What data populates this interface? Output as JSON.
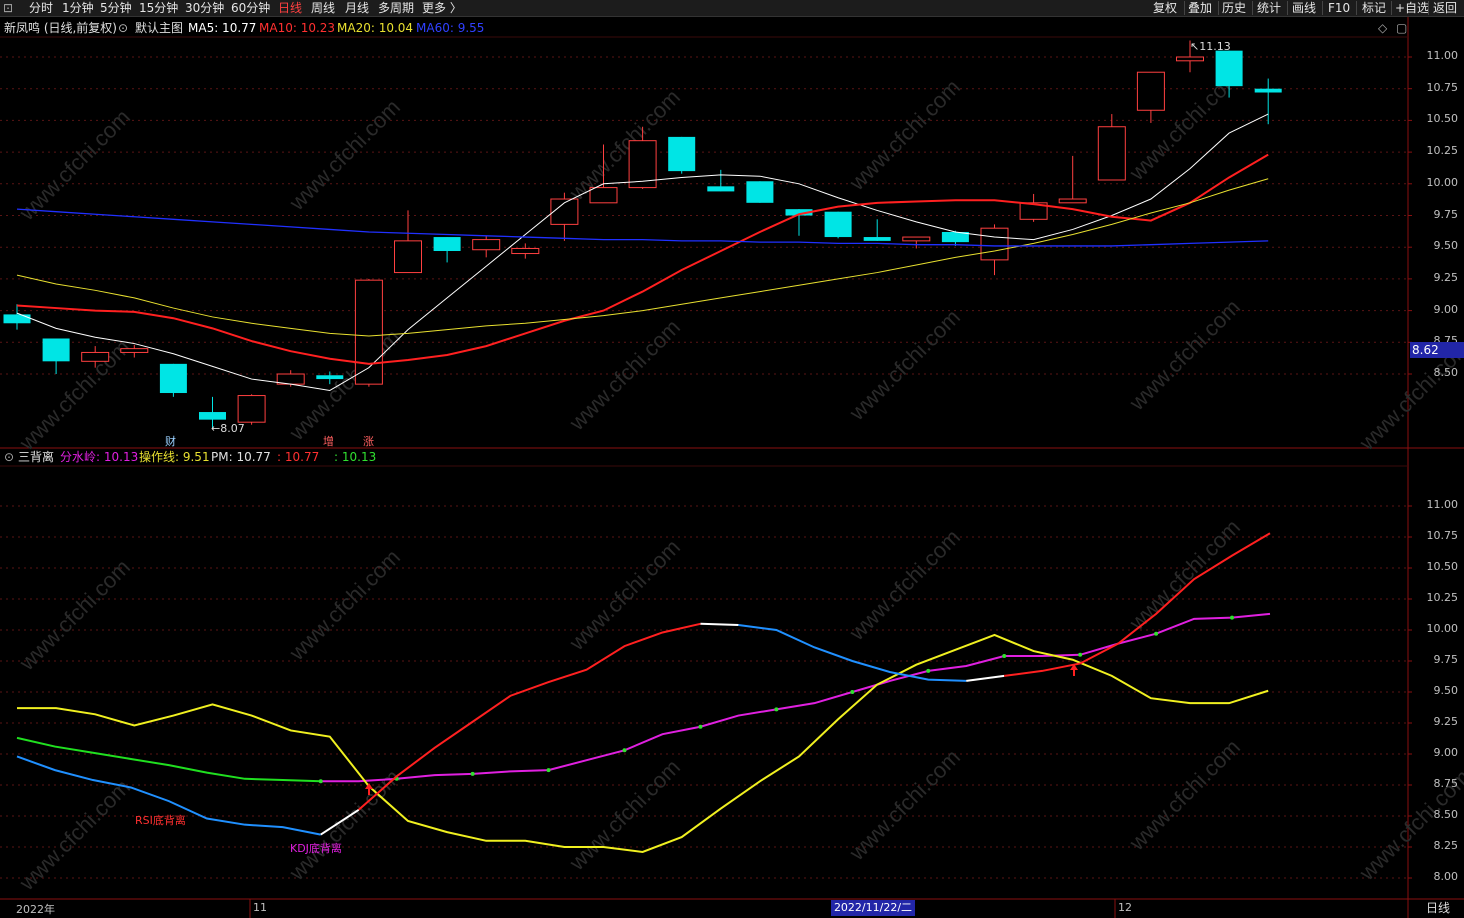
{
  "toolbar": {
    "logo": "⊡",
    "periods": [
      "分时",
      "1分钟",
      "5分钟",
      "15分钟",
      "30分钟",
      "60分钟",
      "日线",
      "周线",
      "月线",
      "多周期",
      "更多 〉"
    ],
    "active_period": "日线",
    "right_buttons": [
      "复权",
      "叠加",
      "历史",
      "统计",
      "画线",
      "F10",
      "标记",
      "+自选",
      "返回"
    ]
  },
  "main_legend": {
    "stock": "新凤鸣 (日线,前复权)",
    "template": "默认主图",
    "ma5": "MA5: 10.77",
    "ma10": "MA10: 10.23",
    "ma20": "MA20: 10.04",
    "ma60": "MA60: 9.55",
    "colors": {
      "ma5": "#ffffff",
      "ma10": "#ff2020",
      "ma20": "#e8e030",
      "ma60": "#2030ff"
    }
  },
  "main_axis": [
    "11.00",
    "10.75",
    "10.50",
    "10.25",
    "10.00",
    "9.75",
    "9.50",
    "9.25",
    "9.00",
    "8.75",
    "8.50"
  ],
  "last_price": "8.62",
  "annotations": {
    "high": "11.13",
    "low": "8.07",
    "tag_cai": "财",
    "tag_zeng": "增",
    "tag_zhang": "涨"
  },
  "sub_legend": {
    "name": "三背离",
    "fenshuiling": "分水岭: 10.13",
    "caozuoxian": "操作线: 9.51",
    "pm": "PM: 10.77",
    "pm2": ": 10.77",
    "val3": ": 10.13"
  },
  "sub_axis": [
    "11.00",
    "10.75",
    "10.50",
    "10.25",
    "10.00",
    "9.75",
    "9.50",
    "9.25",
    "9.00",
    "8.75",
    "8.50",
    "8.25",
    "8.00"
  ],
  "sub_annotations": {
    "rsi": "RSI底背离",
    "kdj": "KDJ底背离"
  },
  "x_axis": {
    "labels": [
      "2022年",
      "11",
      "12"
    ],
    "cursor_date": "2022/11/22/二",
    "period": "日线"
  },
  "watermark": "www.cfchi.com",
  "chart_data": [
    {
      "type": "candlestick",
      "title": "新凤鸣 (日线,前复权)",
      "ylim": [
        8.2,
        11.2
      ],
      "candles": [
        {
          "o": 8.97,
          "h": 9.05,
          "l": 8.85,
          "c": 8.9
        },
        {
          "o": 8.78,
          "h": 8.78,
          "l": 8.5,
          "c": 8.6
        },
        {
          "o": 8.6,
          "h": 8.72,
          "l": 8.55,
          "c": 8.67
        },
        {
          "o": 8.67,
          "h": 8.73,
          "l": 8.63,
          "c": 8.7
        },
        {
          "o": 8.58,
          "h": 8.58,
          "l": 8.32,
          "c": 8.35
        },
        {
          "o": 8.2,
          "h": 8.32,
          "l": 8.07,
          "c": 8.14
        },
        {
          "o": 8.12,
          "h": 8.34,
          "l": 8.1,
          "c": 8.33
        },
        {
          "o": 8.42,
          "h": 8.53,
          "l": 8.4,
          "c": 8.5
        },
        {
          "o": 8.49,
          "h": 8.52,
          "l": 8.42,
          "c": 8.46
        },
        {
          "o": 8.42,
          "h": 9.25,
          "l": 8.4,
          "c": 9.24
        },
        {
          "o": 9.3,
          "h": 9.79,
          "l": 9.3,
          "c": 9.55
        },
        {
          "o": 9.58,
          "h": 9.58,
          "l": 9.38,
          "c": 9.47
        },
        {
          "o": 9.48,
          "h": 9.59,
          "l": 9.42,
          "c": 9.56
        },
        {
          "o": 9.45,
          "h": 9.53,
          "l": 9.41,
          "c": 9.49
        },
        {
          "o": 9.68,
          "h": 9.93,
          "l": 9.55,
          "c": 9.88
        },
        {
          "o": 9.85,
          "h": 10.31,
          "l": 9.85,
          "c": 9.97
        },
        {
          "o": 9.97,
          "h": 10.45,
          "l": 9.96,
          "c": 10.34
        },
        {
          "o": 10.37,
          "h": 10.37,
          "l": 10.08,
          "c": 10.1
        },
        {
          "o": 9.98,
          "h": 10.11,
          "l": 9.94,
          "c": 9.94
        },
        {
          "o": 10.02,
          "h": 10.02,
          "l": 9.85,
          "c": 9.85
        },
        {
          "o": 9.8,
          "h": 9.8,
          "l": 9.59,
          "c": 9.75
        },
        {
          "o": 9.78,
          "h": 9.78,
          "l": 9.57,
          "c": 9.58
        },
        {
          "o": 9.58,
          "h": 9.72,
          "l": 9.55,
          "c": 9.55
        },
        {
          "o": 9.55,
          "h": 9.58,
          "l": 9.49,
          "c": 9.58
        },
        {
          "o": 9.62,
          "h": 9.63,
          "l": 9.51,
          "c": 9.54
        },
        {
          "o": 9.4,
          "h": 9.68,
          "l": 9.28,
          "c": 9.65
        },
        {
          "o": 9.72,
          "h": 9.92,
          "l": 9.7,
          "c": 9.85
        },
        {
          "o": 9.85,
          "h": 10.22,
          "l": 9.85,
          "c": 9.88
        },
        {
          "o": 10.03,
          "h": 10.55,
          "l": 10.03,
          "c": 10.45
        },
        {
          "o": 10.58,
          "h": 10.88,
          "l": 10.48,
          "c": 10.88
        },
        {
          "o": 10.97,
          "h": 11.13,
          "l": 10.88,
          "c": 11.0
        },
        {
          "o": 11.05,
          "h": 11.05,
          "l": 10.68,
          "c": 10.77
        },
        {
          "o": 10.75,
          "h": 10.83,
          "l": 10.47,
          "c": 10.72
        }
      ],
      "series": [
        {
          "name": "MA5",
          "values": [
            8.98,
            8.86,
            8.79,
            8.74,
            8.66,
            8.56,
            8.46,
            8.42,
            8.37,
            8.55,
            8.85,
            9.1,
            9.35,
            9.6,
            9.85,
            10.0,
            10.02,
            10.05,
            10.07,
            10.06,
            10.0,
            9.89,
            9.79,
            9.7,
            9.62,
            9.58,
            9.56,
            9.64,
            9.75,
            9.88,
            10.12,
            10.4,
            10.55
          ]
        },
        {
          "name": "MA10",
          "values": [
            9.04,
            9.02,
            9.0,
            8.99,
            8.94,
            8.86,
            8.76,
            8.68,
            8.62,
            8.58,
            8.61,
            8.65,
            8.72,
            8.82,
            8.92,
            9.0,
            9.15,
            9.32,
            9.47,
            9.62,
            9.76,
            9.82,
            9.85,
            9.86,
            9.87,
            9.87,
            9.84,
            9.8,
            9.74,
            9.71,
            9.85,
            10.05,
            10.23
          ]
        },
        {
          "name": "MA20",
          "values": [
            9.28,
            9.21,
            9.16,
            9.1,
            9.02,
            8.95,
            8.9,
            8.86,
            8.82,
            8.8,
            8.82,
            8.85,
            8.88,
            8.9,
            8.93,
            8.96,
            9.0,
            9.05,
            9.1,
            9.15,
            9.2,
            9.25,
            9.3,
            9.36,
            9.42,
            9.47,
            9.53,
            9.6,
            9.68,
            9.77,
            9.85,
            9.95,
            10.04
          ]
        },
        {
          "name": "MA60",
          "values": [
            9.8,
            9.78,
            9.76,
            9.74,
            9.72,
            9.7,
            9.68,
            9.66,
            9.64,
            9.62,
            9.61,
            9.6,
            9.59,
            9.58,
            9.57,
            9.56,
            9.56,
            9.55,
            9.55,
            9.54,
            9.54,
            9.53,
            9.53,
            9.52,
            9.52,
            9.51,
            9.51,
            9.51,
            9.51,
            9.52,
            9.53,
            9.54,
            9.55
          ]
        }
      ]
    },
    {
      "type": "line",
      "title": "三背离",
      "ylim": [
        7.9,
        11.25
      ],
      "series": [
        {
          "name": "分水岭",
          "values": [
            9.13,
            9.06,
            9.01,
            8.96,
            8.91,
            8.85,
            8.8,
            8.79,
            8.78,
            8.78,
            8.8,
            8.83,
            8.84,
            8.86,
            8.87,
            8.95,
            9.03,
            9.16,
            9.22,
            9.31,
            9.36,
            9.41,
            9.5,
            9.59,
            9.67,
            9.71,
            9.79,
            9.79,
            9.8,
            9.89,
            9.97,
            10.09,
            10.1,
            10.13
          ]
        },
        {
          "name": "操作线",
          "values": [
            9.37,
            9.37,
            9.32,
            9.23,
            9.31,
            9.4,
            9.31,
            9.19,
            9.14,
            8.74,
            8.46,
            8.37,
            8.3,
            8.3,
            8.25,
            8.25,
            8.21,
            8.33,
            8.56,
            8.78,
            8.98,
            9.28,
            9.56,
            9.72,
            9.84,
            9.96,
            9.83,
            9.76,
            9.63,
            9.45,
            9.41,
            9.41,
            9.51
          ]
        },
        {
          "name": "PM",
          "values": [
            8.98,
            8.87,
            8.79,
            8.73,
            8.62,
            8.48,
            8.43,
            8.41,
            8.35,
            8.55,
            8.82,
            9.05,
            9.26,
            9.47,
            9.58,
            9.68,
            9.87,
            9.98,
            10.05,
            10.04,
            10.0,
            9.86,
            9.75,
            9.66,
            9.6,
            9.59,
            9.63,
            9.67,
            9.73,
            9.89,
            10.13,
            10.41,
            10.6,
            10.78
          ]
        }
      ]
    }
  ]
}
